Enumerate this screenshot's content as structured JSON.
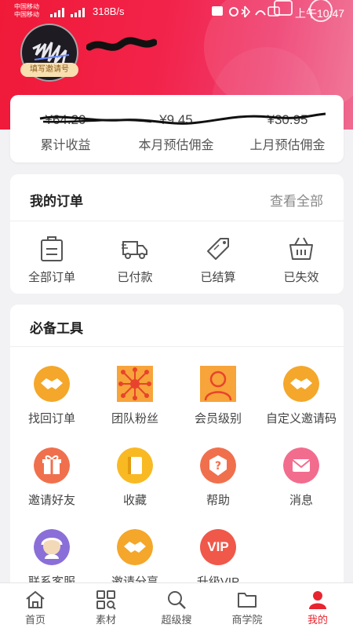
{
  "status_bar": {
    "carrier_1": "中国移动",
    "carrier_2": "中国移动",
    "network_speed": "318B/s",
    "time": "上午10:47"
  },
  "profile": {
    "invite_tag": "填写邀请号"
  },
  "earnings": [
    {
      "amount": "¥64.20",
      "label": "累计收益"
    },
    {
      "amount": "¥9.45",
      "label": "本月预估佣金"
    },
    {
      "amount": "¥30.95",
      "label": "上月预估佣金"
    }
  ],
  "orders": {
    "title": "我的订单",
    "view_all": "查看全部",
    "items": [
      {
        "label": "全部订单",
        "icon": "clipboard-icon"
      },
      {
        "label": "已付款",
        "icon": "truck-icon"
      },
      {
        "label": "已结算",
        "icon": "tag-icon"
      },
      {
        "label": "已失效",
        "icon": "basket-icon"
      }
    ]
  },
  "tools": {
    "title": "必备工具",
    "items": [
      {
        "label": "找回订单",
        "icon": "handshake-icon"
      },
      {
        "label": "团队粉丝",
        "icon": "team-network-icon"
      },
      {
        "label": "会员级别",
        "icon": "member-icon"
      },
      {
        "label": "自定义邀请码",
        "icon": "handshake-icon"
      },
      {
        "label": "邀请好友",
        "icon": "gift-icon"
      },
      {
        "label": "收藏",
        "icon": "book-icon"
      },
      {
        "label": "帮助",
        "icon": "help-icon"
      },
      {
        "label": "消息",
        "icon": "mail-icon"
      },
      {
        "label": "联系客服",
        "icon": "customer-service-icon"
      },
      {
        "label": "邀请分享",
        "icon": "handshake-icon"
      },
      {
        "label": "升级VIP",
        "icon": "vip-icon"
      }
    ],
    "vip_badge": "VIP"
  },
  "tabbar": [
    {
      "label": "首页",
      "icon": "home-icon"
    },
    {
      "label": "素材",
      "icon": "grid-icon"
    },
    {
      "label": "超级搜",
      "icon": "search-icon"
    },
    {
      "label": "商学院",
      "icon": "folder-icon"
    },
    {
      "label": "我的",
      "icon": "user-icon",
      "active": true
    }
  ],
  "colors": {
    "brand_red": "#f01938",
    "active_tab": "#e8242f",
    "tool_orange": "#f5a623"
  }
}
